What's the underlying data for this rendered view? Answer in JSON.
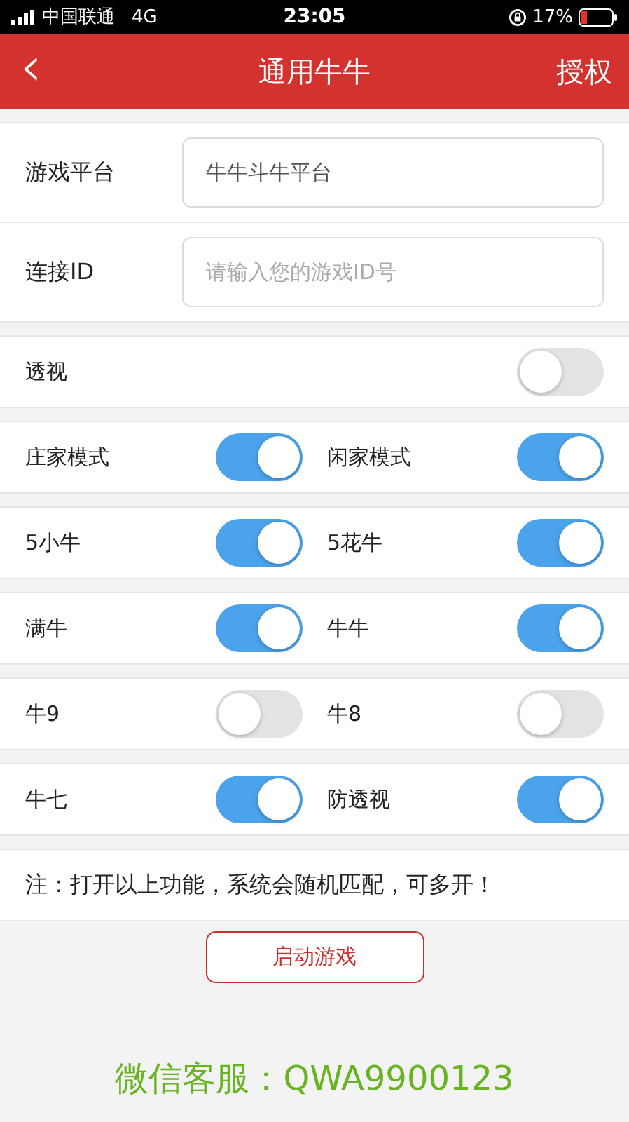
{
  "status_bar": {
    "carrier": "中国联通",
    "network": "4G",
    "time": "23:05",
    "battery": "17%"
  },
  "header": {
    "back": "‹",
    "title": "通用牛牛",
    "action": "授权"
  },
  "form": [
    {
      "label": "游戏平台",
      "value": "牛牛斗牛平台"
    },
    {
      "label": "连接ID",
      "placeholder": "请输入您的游戏ID号"
    }
  ],
  "single_toggle": {
    "label": "透视",
    "on": false
  },
  "toggle_rows": [
    {
      "items": [
        {
          "label": "庄家模式",
          "on": true
        },
        {
          "label": "闲家模式",
          "on": true
        }
      ]
    },
    {
      "items": [
        {
          "label": "5小牛",
          "on": true
        },
        {
          "label": "5花牛",
          "on": true
        }
      ]
    },
    {
      "items": [
        {
          "label": "满牛",
          "on": true
        },
        {
          "label": "牛牛",
          "on": true
        }
      ]
    },
    {
      "items": [
        {
          "label": "牛9",
          "on": false
        },
        {
          "label": "牛8",
          "on": false
        }
      ]
    },
    {
      "items": [
        {
          "label": "牛七",
          "on": true
        },
        {
          "label": "防透视",
          "on": true
        }
      ]
    }
  ],
  "note": "注：打开以上功能，系统会随机匹配，可多开！",
  "start_button": "启动游戏",
  "contact": "微信客服：QWA9900123"
}
